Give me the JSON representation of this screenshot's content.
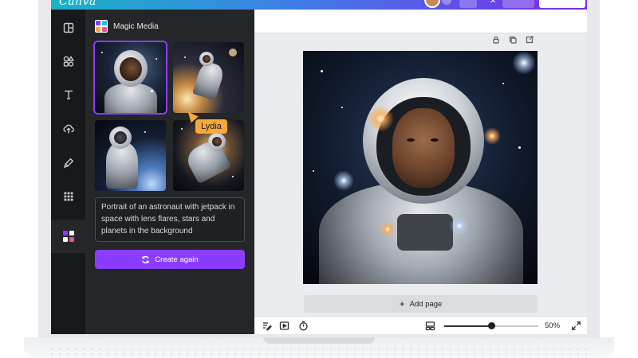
{
  "app": {
    "logo_text": "Canva"
  },
  "panel": {
    "title": "Magic Media",
    "tooltip_user": "Lydia",
    "prompt_text": "Portrait of an astronaut with jetpack in space with lens flares, stars and planets in the background",
    "create_button_label": "Create again"
  },
  "rail": {
    "items": [
      "design-icon",
      "elements-icon",
      "text-icon",
      "uploads-icon",
      "draw-icon",
      "apps-icon",
      "magic-media-icon"
    ]
  },
  "canvas": {
    "add_page_label": "Add page"
  },
  "footer": {
    "zoom_level": "50%",
    "zoom_fraction": 0.5
  },
  "colors": {
    "accent": "#8b3dff",
    "tooltip": "#f6a83a",
    "rail_bg": "#18191b",
    "panel_bg": "#252627"
  }
}
